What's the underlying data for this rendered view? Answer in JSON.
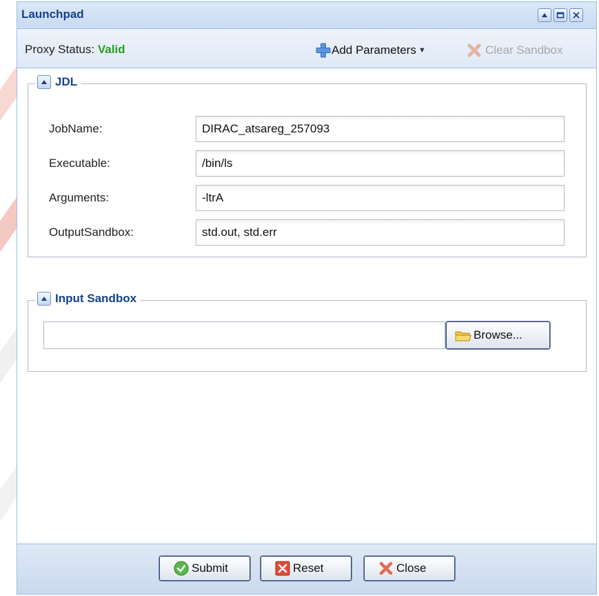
{
  "window": {
    "title": "Launchpad"
  },
  "toolbar": {
    "proxy_label": "Proxy Status:",
    "proxy_value": "Valid",
    "add_params_label": "Add Parameters",
    "clear_sandbox_label": "Clear Sandbox"
  },
  "jdl": {
    "legend": "JDL",
    "fields": [
      {
        "label": "JobName:",
        "value": "DIRAC_atsareg_257093"
      },
      {
        "label": "Executable:",
        "value": "/bin/ls"
      },
      {
        "label": "Arguments:",
        "value": "-ltrA"
      },
      {
        "label": "OutputSandbox:",
        "value": "std.out, std.err"
      }
    ]
  },
  "input_sandbox": {
    "legend": "Input Sandbox",
    "file_value": "",
    "browse_label": "Browse..."
  },
  "footer": {
    "submit_label": "Submit",
    "reset_label": "Reset",
    "close_label": "Close"
  },
  "icons": {
    "window_tools": [
      "collapse-icon",
      "maximize-icon",
      "close-icon"
    ],
    "add": "plus-icon",
    "clear": "x-icon",
    "browse": "folder-icon",
    "submit": "check-icon",
    "reset": "reset-icon",
    "close": "x-icon"
  },
  "colors": {
    "title": "#15428b",
    "valid": "#2a9d1f",
    "disabled": "#a9a9a9",
    "accent_stripe": "#e84a3a"
  }
}
